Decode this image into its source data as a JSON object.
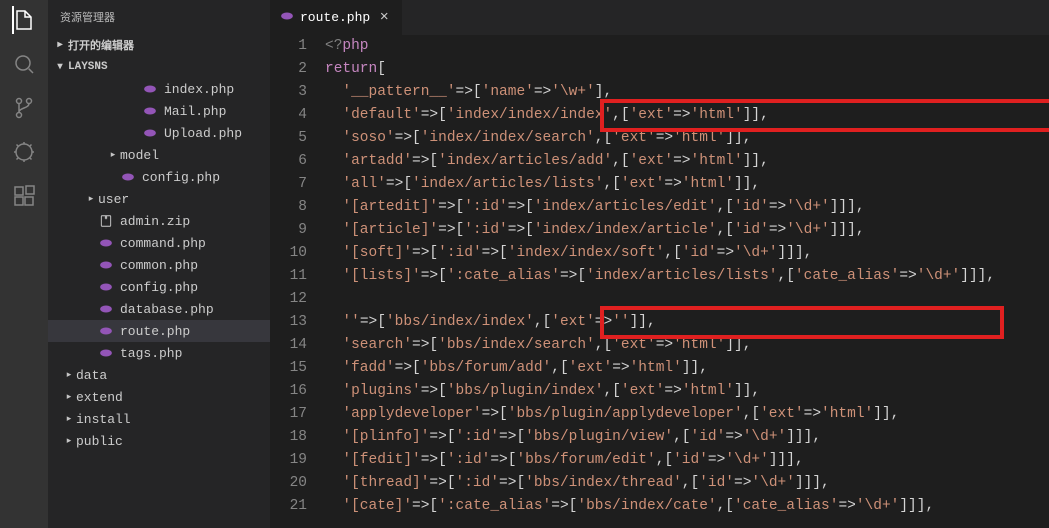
{
  "sidebar": {
    "title": "资源管理器",
    "sections": {
      "open_editors": "打开的编辑器",
      "project": "LAYSNS"
    },
    "tree": [
      {
        "indent": 80,
        "icon": "php",
        "label": "index.php",
        "chev": ""
      },
      {
        "indent": 80,
        "icon": "php",
        "label": "Mail.php",
        "chev": ""
      },
      {
        "indent": 80,
        "icon": "php",
        "label": "Upload.php",
        "chev": ""
      },
      {
        "indent": 58,
        "icon": "folder",
        "label": "model",
        "chev": "▸"
      },
      {
        "indent": 58,
        "icon": "php",
        "label": "config.php",
        "chev": ""
      },
      {
        "indent": 36,
        "icon": "folder",
        "label": "user",
        "chev": "▸"
      },
      {
        "indent": 36,
        "icon": "zip",
        "label": "admin.zip",
        "chev": ""
      },
      {
        "indent": 36,
        "icon": "php",
        "label": "command.php",
        "chev": ""
      },
      {
        "indent": 36,
        "icon": "php",
        "label": "common.php",
        "chev": ""
      },
      {
        "indent": 36,
        "icon": "php",
        "label": "config.php",
        "chev": ""
      },
      {
        "indent": 36,
        "icon": "php",
        "label": "database.php",
        "chev": ""
      },
      {
        "indent": 36,
        "icon": "php",
        "label": "route.php",
        "chev": "",
        "selected": true
      },
      {
        "indent": 36,
        "icon": "php",
        "label": "tags.php",
        "chev": ""
      },
      {
        "indent": 14,
        "icon": "folder",
        "label": "data",
        "chev": "▸"
      },
      {
        "indent": 14,
        "icon": "folder",
        "label": "extend",
        "chev": "▸"
      },
      {
        "indent": 14,
        "icon": "folder",
        "label": "install",
        "chev": "▸"
      },
      {
        "indent": 14,
        "icon": "folder",
        "label": "public",
        "chev": "▸"
      }
    ]
  },
  "tabs": {
    "active": {
      "label": "route.php"
    }
  },
  "code": {
    "lines": [
      {
        "n": 1,
        "tokens": [
          [
            "tag",
            "<?"
          ],
          [
            "kw",
            "php"
          ]
        ]
      },
      {
        "n": 2,
        "tokens": [
          [
            "kw",
            "return"
          ],
          [
            "pun",
            "["
          ]
        ]
      },
      {
        "n": 3,
        "tokens": [
          [
            "str",
            "'__pattern__'"
          ],
          [
            "pun",
            "=>["
          ],
          [
            "str",
            "'name'"
          ],
          [
            "pun",
            "=>"
          ],
          [
            "str",
            "'\\w+'"
          ],
          [
            "pun",
            "],"
          ]
        ]
      },
      {
        "n": 4,
        "tokens": [
          [
            "str",
            "'default'"
          ],
          [
            "pun",
            "=>["
          ],
          [
            "str",
            "'index/index/index'"
          ],
          [
            "pun",
            ",["
          ],
          [
            "str",
            "'ext'"
          ],
          [
            "pun",
            "=>"
          ],
          [
            "str",
            "'html'"
          ],
          [
            "pun",
            "]],"
          ]
        ]
      },
      {
        "n": 5,
        "tokens": [
          [
            "str",
            "'soso'"
          ],
          [
            "pun",
            "=>["
          ],
          [
            "str",
            "'index/index/search'"
          ],
          [
            "pun",
            ",["
          ],
          [
            "str",
            "'ext'"
          ],
          [
            "pun",
            "=>"
          ],
          [
            "str",
            "'html'"
          ],
          [
            "pun",
            "]],"
          ]
        ]
      },
      {
        "n": 6,
        "tokens": [
          [
            "str",
            "'artadd'"
          ],
          [
            "pun",
            "=>["
          ],
          [
            "str",
            "'index/articles/add'"
          ],
          [
            "pun",
            ",["
          ],
          [
            "str",
            "'ext'"
          ],
          [
            "pun",
            "=>"
          ],
          [
            "str",
            "'html'"
          ],
          [
            "pun",
            "]],"
          ]
        ]
      },
      {
        "n": 7,
        "tokens": [
          [
            "str",
            "'all'"
          ],
          [
            "pun",
            "=>["
          ],
          [
            "str",
            "'index/articles/lists'"
          ],
          [
            "pun",
            ",["
          ],
          [
            "str",
            "'ext'"
          ],
          [
            "pun",
            "=>"
          ],
          [
            "str",
            "'html'"
          ],
          [
            "pun",
            "]],"
          ]
        ]
      },
      {
        "n": 8,
        "tokens": [
          [
            "str",
            "'[artedit]'"
          ],
          [
            "pun",
            "=>["
          ],
          [
            "str",
            "':id'"
          ],
          [
            "pun",
            "=>["
          ],
          [
            "str",
            "'index/articles/edit'"
          ],
          [
            "pun",
            ",["
          ],
          [
            "str",
            "'id'"
          ],
          [
            "pun",
            "=>"
          ],
          [
            "str",
            "'\\d+'"
          ],
          [
            "pun",
            "]]],"
          ]
        ]
      },
      {
        "n": 9,
        "tokens": [
          [
            "str",
            "'[article]'"
          ],
          [
            "pun",
            "=>["
          ],
          [
            "str",
            "':id'"
          ],
          [
            "pun",
            "=>["
          ],
          [
            "str",
            "'index/index/article'"
          ],
          [
            "pun",
            ",["
          ],
          [
            "str",
            "'id'"
          ],
          [
            "pun",
            "=>"
          ],
          [
            "str",
            "'\\d+'"
          ],
          [
            "pun",
            "]]],"
          ]
        ]
      },
      {
        "n": 10,
        "tokens": [
          [
            "str",
            "'[soft]'"
          ],
          [
            "pun",
            "=>["
          ],
          [
            "str",
            "':id'"
          ],
          [
            "pun",
            "=>["
          ],
          [
            "str",
            "'index/index/soft'"
          ],
          [
            "pun",
            ",["
          ],
          [
            "str",
            "'id'"
          ],
          [
            "pun",
            "=>"
          ],
          [
            "str",
            "'\\d+'"
          ],
          [
            "pun",
            "]]],"
          ]
        ]
      },
      {
        "n": 11,
        "tokens": [
          [
            "str",
            "'[lists]'"
          ],
          [
            "pun",
            "=>["
          ],
          [
            "str",
            "':cate_alias'"
          ],
          [
            "pun",
            "=>["
          ],
          [
            "str",
            "'index/articles/lists'"
          ],
          [
            "pun",
            ",["
          ],
          [
            "str",
            "'cate_alias'"
          ],
          [
            "pun",
            "=>"
          ],
          [
            "str",
            "'\\d+'"
          ],
          [
            "pun",
            "]]],"
          ]
        ]
      },
      {
        "n": 12,
        "tokens": []
      },
      {
        "n": 13,
        "tokens": [
          [
            "str",
            "''"
          ],
          [
            "pun",
            "=>["
          ],
          [
            "str",
            "'bbs/index/index'"
          ],
          [
            "pun",
            ",["
          ],
          [
            "str",
            "'ext'"
          ],
          [
            "pun",
            "=>"
          ],
          [
            "str",
            "''"
          ],
          [
            "pun",
            "]],"
          ]
        ]
      },
      {
        "n": 14,
        "tokens": [
          [
            "str",
            "'search'"
          ],
          [
            "pun",
            "=>["
          ],
          [
            "str",
            "'bbs/index/search'"
          ],
          [
            "pun",
            ",["
          ],
          [
            "str",
            "'ext'"
          ],
          [
            "pun",
            "=>"
          ],
          [
            "str",
            "'html'"
          ],
          [
            "pun",
            "]],"
          ]
        ]
      },
      {
        "n": 15,
        "tokens": [
          [
            "str",
            "'fadd'"
          ],
          [
            "pun",
            "=>["
          ],
          [
            "str",
            "'bbs/forum/add'"
          ],
          [
            "pun",
            ",["
          ],
          [
            "str",
            "'ext'"
          ],
          [
            "pun",
            "=>"
          ],
          [
            "str",
            "'html'"
          ],
          [
            "pun",
            "]],"
          ]
        ]
      },
      {
        "n": 16,
        "tokens": [
          [
            "str",
            "'plugins'"
          ],
          [
            "pun",
            "=>["
          ],
          [
            "str",
            "'bbs/plugin/index'"
          ],
          [
            "pun",
            ",["
          ],
          [
            "str",
            "'ext'"
          ],
          [
            "pun",
            "=>"
          ],
          [
            "str",
            "'html'"
          ],
          [
            "pun",
            "]],"
          ]
        ]
      },
      {
        "n": 17,
        "tokens": [
          [
            "str",
            "'applydeveloper'"
          ],
          [
            "pun",
            "=>["
          ],
          [
            "str",
            "'bbs/plugin/applydeveloper'"
          ],
          [
            "pun",
            ",["
          ],
          [
            "str",
            "'ext'"
          ],
          [
            "pun",
            "=>"
          ],
          [
            "str",
            "'html'"
          ],
          [
            "pun",
            "]],"
          ]
        ]
      },
      {
        "n": 18,
        "tokens": [
          [
            "str",
            "'[plinfo]'"
          ],
          [
            "pun",
            "=>["
          ],
          [
            "str",
            "':id'"
          ],
          [
            "pun",
            "=>["
          ],
          [
            "str",
            "'bbs/plugin/view'"
          ],
          [
            "pun",
            ",["
          ],
          [
            "str",
            "'id'"
          ],
          [
            "pun",
            "=>"
          ],
          [
            "str",
            "'\\d+'"
          ],
          [
            "pun",
            "]]],"
          ]
        ]
      },
      {
        "n": 19,
        "tokens": [
          [
            "str",
            "'[fedit]'"
          ],
          [
            "pun",
            "=>["
          ],
          [
            "str",
            "':id'"
          ],
          [
            "pun",
            "=>["
          ],
          [
            "str",
            "'bbs/forum/edit'"
          ],
          [
            "pun",
            ",["
          ],
          [
            "str",
            "'id'"
          ],
          [
            "pun",
            "=>"
          ],
          [
            "str",
            "'\\d+'"
          ],
          [
            "pun",
            "]]],"
          ]
        ]
      },
      {
        "n": 20,
        "tokens": [
          [
            "str",
            "'[thread]'"
          ],
          [
            "pun",
            "=>["
          ],
          [
            "str",
            "':id'"
          ],
          [
            "pun",
            "=>["
          ],
          [
            "str",
            "'bbs/index/thread'"
          ],
          [
            "pun",
            ",["
          ],
          [
            "str",
            "'id'"
          ],
          [
            "pun",
            "=>"
          ],
          [
            "str",
            "'\\d+'"
          ],
          [
            "pun",
            "]]],"
          ]
        ]
      },
      {
        "n": 21,
        "tokens": [
          [
            "str",
            "'[cate]'"
          ],
          [
            "pun",
            "=>["
          ],
          [
            "str",
            "':cate_alias'"
          ],
          [
            "pun",
            "=>["
          ],
          [
            "str",
            "'bbs/index/cate'"
          ],
          [
            "pun",
            ",["
          ],
          [
            "str",
            "'cate_alias'"
          ],
          [
            "pun",
            "=>"
          ],
          [
            "str",
            "'\\d+'"
          ],
          [
            "pun",
            "]]],"
          ]
        ]
      }
    ]
  }
}
